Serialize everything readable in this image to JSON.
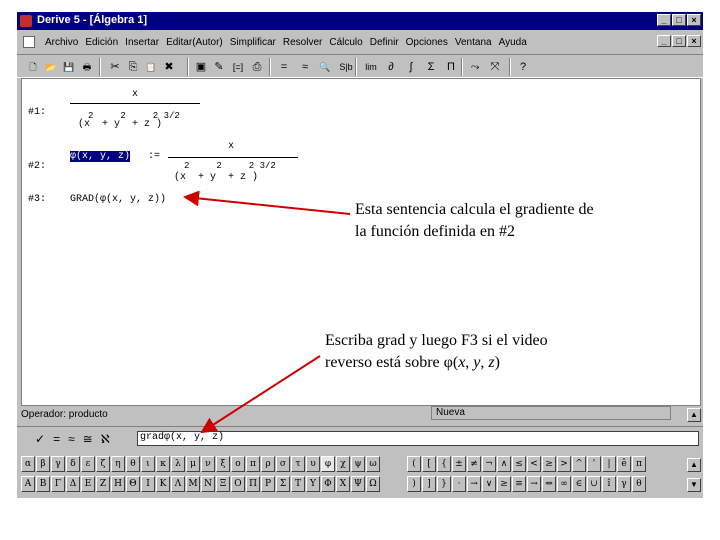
{
  "window": {
    "title": "Derive 5 - [Álgebra 1]",
    "controls": [
      "_",
      "□",
      "×"
    ]
  },
  "menu": {
    "items": [
      "Archivo",
      "Edición",
      "Insertar",
      "Editar(Autor)",
      "Simplificar",
      "Resolver",
      "Cálculo",
      "Definir",
      "Opciones",
      "Ventana",
      "Ayuda"
    ]
  },
  "toolbar": {
    "buttons": [
      {
        "label": "🗋",
        "icon": "new-icon"
      },
      {
        "label": "📂",
        "icon": "open-icon"
      },
      {
        "label": "💾",
        "icon": "save-icon"
      },
      {
        "label": "🖶",
        "icon": "print-icon"
      },
      {
        "label": "✂",
        "icon": "cut-icon"
      },
      {
        "label": "⎘",
        "icon": "copy-icon"
      },
      {
        "label": "📋",
        "icon": "paste-icon"
      },
      {
        "label": "✖",
        "icon": "delete-icon"
      },
      {
        "label": "▣",
        "icon": "text-icon"
      },
      {
        "label": "✎",
        "icon": "edit-icon"
      },
      {
        "label": "[=]",
        "icon": "matrix-icon"
      },
      {
        "label": "⎙",
        "icon": "plot-icon"
      },
      {
        "label": "=",
        "icon": "simplify-icon"
      },
      {
        "label": "≈",
        "icon": "approx-icon"
      },
      {
        "label": "🔍",
        "icon": "find-icon"
      },
      {
        "label": "S|b",
        "icon": "substitute-icon"
      },
      {
        "label": "lim",
        "icon": "limit-icon"
      },
      {
        "label": "∂",
        "icon": "derivative-icon"
      },
      {
        "label": "∫",
        "icon": "integral-icon"
      },
      {
        "label": "Σ",
        "icon": "sum-icon"
      },
      {
        "label": "Π",
        "icon": "product-icon"
      },
      {
        "label": "⤳",
        "icon": "plot2d-icon"
      },
      {
        "label": "⤧",
        "icon": "plot3d-icon"
      },
      {
        "label": "?",
        "icon": "help-icon"
      }
    ]
  },
  "expressions": [
    {
      "label": "#1:",
      "numerator": "x",
      "denominator": "(x  + y  + z )",
      "exponents": "2     2     2 3/2"
    },
    {
      "label": "#2:",
      "lhs": "φ(x, y, z)",
      "assign": ":=",
      "numerator": "x",
      "denominator": "(x  + y  + z )",
      "exponents": "2     2     2 3/2"
    },
    {
      "label": "#3:",
      "text": "GRAD(φ(x, y, z))"
    }
  ],
  "annotations": [
    {
      "lines": [
        "Esta sentencia calcula el gradiente de",
        "la función definida en #2"
      ]
    },
    {
      "line1": "Escriba grad y luego F3 si el video",
      "line2_pre": "reverso está sobre φ(",
      "x": "x",
      "sep1": ", ",
      "y": "y",
      "sep2": ", ",
      "z": "z",
      "close": ")"
    }
  ],
  "status": {
    "left": "Operador: producto",
    "right": "Nueva"
  },
  "input": {
    "buttons": [
      "✓",
      "=",
      "≈",
      "≅",
      "ℵ"
    ],
    "value": "gradφ(x, y, z)"
  },
  "palette_left": {
    "row1": [
      "α",
      "β",
      "γ",
      "δ",
      "ε",
      "ζ",
      "η",
      "θ",
      "ι",
      "κ",
      "λ",
      "μ",
      "ν",
      "ξ",
      "ο",
      "π",
      "ρ",
      "σ",
      "τ",
      "υ",
      "φ",
      "χ",
      "ψ",
      "ω"
    ],
    "row2": [
      "Α",
      "Β",
      "Γ",
      "Δ",
      "Ε",
      "Ζ",
      "Η",
      "Θ",
      "Ι",
      "Κ",
      "Λ",
      "Μ",
      "Ν",
      "Ξ",
      "Ο",
      "Π",
      "Ρ",
      "Σ",
      "Τ",
      "Υ",
      "Φ",
      "Χ",
      "Ψ",
      "Ω"
    ],
    "selected": "φ"
  },
  "palette_right": {
    "row1": [
      "(",
      "[",
      "{",
      "±",
      "≠",
      "¬",
      "∧",
      "≤",
      "<",
      "≥",
      ">",
      "^",
      "'",
      "|",
      "ê",
      "π"
    ],
    "row2": [
      ")",
      "]",
      "}",
      "·",
      "→",
      "∨",
      "≥",
      "≡",
      "→",
      "⇔",
      "∞",
      "∈",
      "∪",
      "î",
      "γ",
      "θ"
    ]
  }
}
